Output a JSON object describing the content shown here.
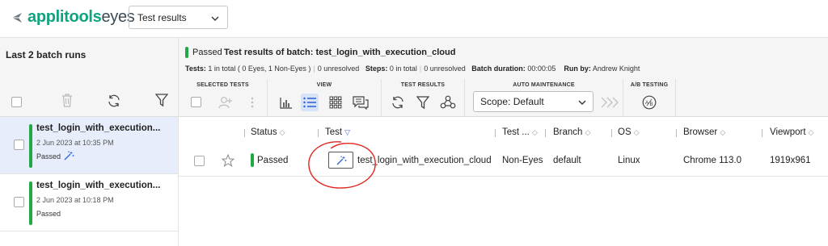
{
  "app": {
    "logo_text": "applitools",
    "logo_text_2": "eyes",
    "context_select": "Test results"
  },
  "batch_list": {
    "title": "Last 2 batch runs",
    "items": [
      {
        "name": "test_login_with_execution...",
        "date": "2 Jun 2023 at 10:35 PM",
        "status": "Passed",
        "selected": true
      },
      {
        "name": "test_login_with_execution...",
        "date": "2 Jun 2023 at 10:18 PM",
        "status": "Passed",
        "selected": false
      }
    ]
  },
  "batch_header": {
    "status": "Passed",
    "title": "Test results of batch:  test_login_with_execution_cloud",
    "tests_label": "Tests:",
    "tests_value": "1 in total ( 0 Eyes, 1 Non-Eyes )",
    "unresolved_1": "0 unresolved",
    "steps_label": "Steps:",
    "steps_value": "0 in total",
    "unresolved_2": "0 unresolved",
    "duration_label": "Batch duration:",
    "duration_value": "00:00:05",
    "runby_label": "Run by:",
    "runby_value": "Andrew Knight"
  },
  "toolbar": {
    "selected_tests": "SELECTED TESTS",
    "view": "VIEW",
    "test_results": "TEST RESULTS",
    "auto_maintenance": "AUTO MAINTENANCE",
    "ab_testing": "A/B TESTING",
    "scope": "Scope: Default"
  },
  "table": {
    "columns": {
      "status": "Status",
      "test": "Test",
      "test_type": "Test ...",
      "branch": "Branch",
      "os": "OS",
      "browser": "Browser",
      "viewport": "Viewport"
    },
    "rows": [
      {
        "status": "Passed",
        "test": "test_login_with_execution_cloud",
        "test_type": "Non-Eyes",
        "branch": "default",
        "os": "Linux",
        "browser": "Chrome 113.0",
        "viewport": "1919x961"
      }
    ]
  },
  "colors": {
    "brand": "#0fa37f",
    "passed": "#22a846",
    "selection": "#e7edfb",
    "annotation": "#e0271f"
  }
}
